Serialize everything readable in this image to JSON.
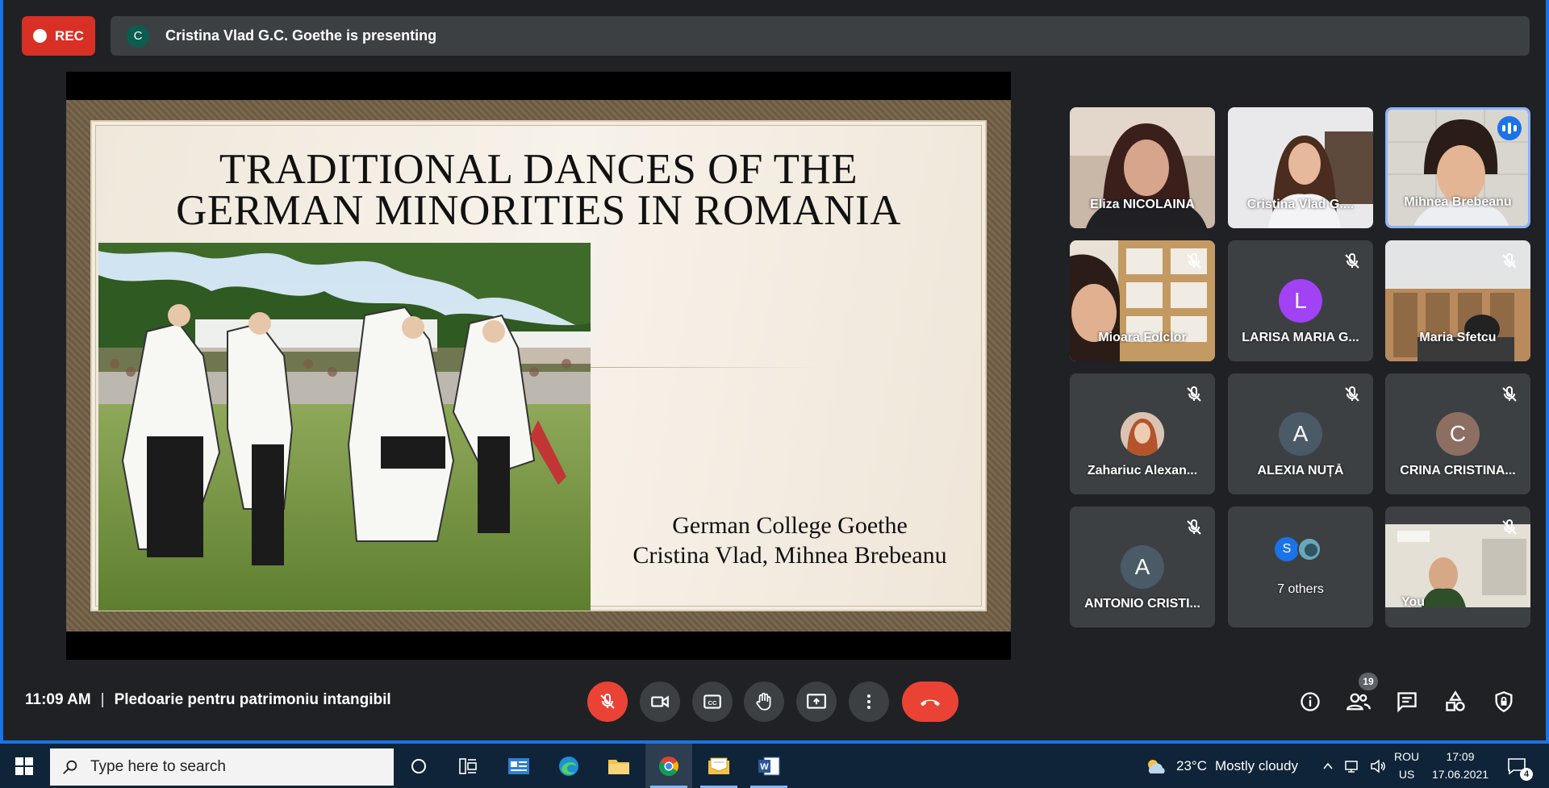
{
  "top_bar": {
    "rec_label": "REC",
    "presenter_avatar_letter": "C",
    "presenting_text": "Cristina Vlad G.C. Goethe is presenting"
  },
  "slide": {
    "title_line1": "TRADITIONAL DANCES OF THE",
    "title_line2": "GERMAN MINORITIES IN ROMANIA",
    "subtitle_line1": "German College Goethe",
    "subtitle_line2": "Cristina Vlad, Mihnea Brebeanu"
  },
  "participants": [
    {
      "name": "Eliza NICOLAINA",
      "type": "video"
    },
    {
      "name": "Cristina Vlad G....",
      "type": "video"
    },
    {
      "name": "Mihnea Brebeanu",
      "type": "video",
      "speaking": true
    },
    {
      "name": "Mioara Folclor",
      "type": "video",
      "muted": true
    },
    {
      "name": "LARISA MARIA G...",
      "type": "avatar",
      "letter": "L",
      "color": "#a142f4",
      "muted": true
    },
    {
      "name": "Maria Sfetcu",
      "type": "video",
      "muted": true
    },
    {
      "name": "Zahariuc Alexan...",
      "type": "photo-avatar",
      "muted": true
    },
    {
      "name": "ALEXIA NUȚĂ",
      "type": "avatar",
      "letter": "A",
      "color": "#4a5a66",
      "muted": true
    },
    {
      "name": "CRINA CRISTINA...",
      "type": "avatar",
      "letter": "C",
      "color": "#8d6e63",
      "muted": true
    },
    {
      "name": "ANTONIO CRISTI...",
      "type": "avatar",
      "letter": "A",
      "color": "#4a5a66",
      "muted": true
    },
    {
      "name": "7 others",
      "type": "others",
      "letter": "S"
    },
    {
      "name": "You",
      "type": "video",
      "muted": true
    }
  ],
  "bottom_bar": {
    "time": "11:09 AM",
    "separator": "|",
    "meeting_title": "Pledoarie pentru patrimoniu intangibil",
    "participant_count": "19"
  },
  "taskbar": {
    "search_placeholder": "Type here to search",
    "weather_temp": "23°C",
    "weather_text": "Mostly cloudy",
    "lang_line1": "ROU",
    "lang_line2": "US",
    "clock_time": "17:09",
    "clock_date": "17.06.2021",
    "notification_count": "4"
  },
  "colors": {
    "meet_bg": "#202124",
    "tile_bg": "#3c4043",
    "rec_red": "#d93025",
    "end_call_red": "#ea4335",
    "accent_blue": "#1a73e8",
    "taskbar_bg": "#0f2438"
  }
}
